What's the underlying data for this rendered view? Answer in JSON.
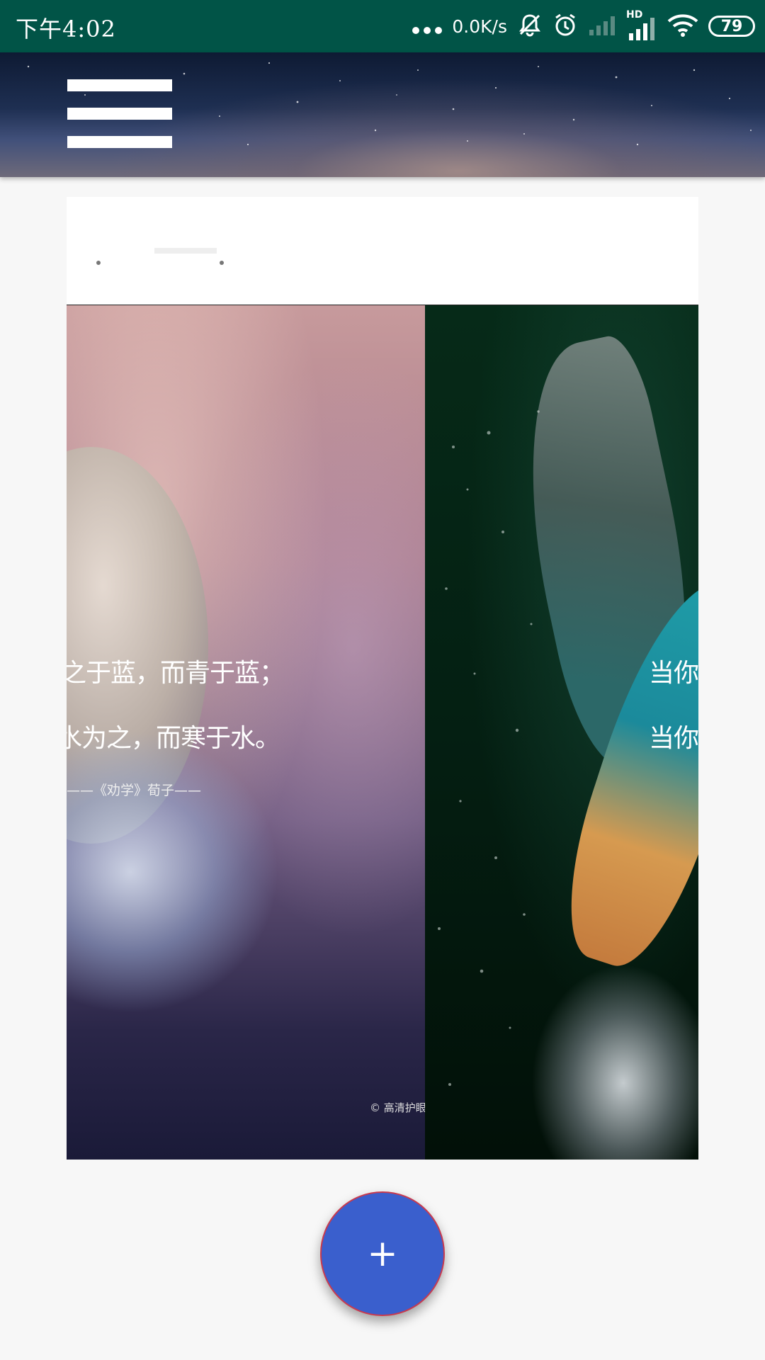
{
  "status_bar": {
    "time": "下午4:02",
    "network_speed": "0.0K/s",
    "signal_label": "HD",
    "battery": "79",
    "icons": [
      "more-dots-icon",
      "mute-bell-icon",
      "alarm-icon",
      "signal-icon",
      "hd-signal-icon",
      "wifi-icon",
      "battery-icon"
    ]
  },
  "header": {
    "menu_icon": "hamburger-menu-icon"
  },
  "carousel": {
    "slides": [
      {
        "lines": [
          "之于蓝，而青于蓝；",
          "水为之，而寒于水。"
        ],
        "attribution": "——《劝学》荀子——",
        "watermark": "© 高清护眼模式"
      },
      {
        "lines": [
          "当你能飞",
          "当你能梦"
        ]
      }
    ]
  },
  "fab": {
    "label": "+",
    "color": "#3a5fcd"
  },
  "colors": {
    "status_bar": "#015447",
    "background": "#f7f7f7"
  }
}
